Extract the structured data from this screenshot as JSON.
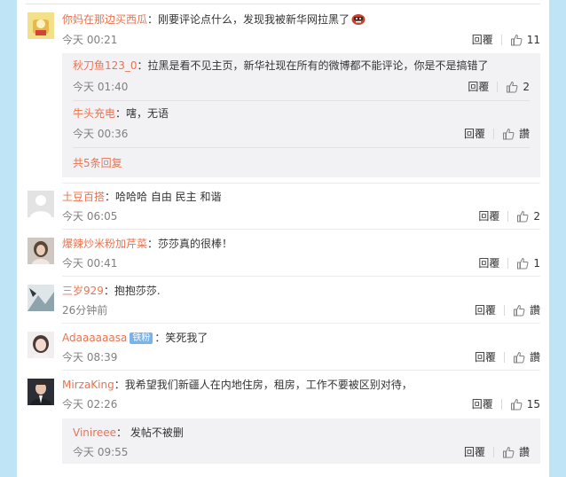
{
  "common": {
    "reply": "回覆",
    "like_placeholder": "讚"
  },
  "comments": [
    {
      "user": "你妈在那边买西瓜",
      "text": "：刚要评论点什么，发现我被新华网拉黑了",
      "time": "今天 00:21",
      "likes": "11"
    },
    {
      "user": "土豆百搭",
      "text": "：哈哈哈 自由 民主 和谐",
      "time": "今天 06:05",
      "likes": "2"
    },
    {
      "user": "爆辣炒米粉加芹菜",
      "text": "：莎莎真的很棒！",
      "time": "今天 00:41",
      "likes": "1"
    },
    {
      "user": "三岁929",
      "text": "：抱抱莎莎.",
      "time": "26分钟前",
      "likes": "讚"
    },
    {
      "user": "Adaaaaaasa",
      "badge": "铁粉",
      "text": "：笑死我了",
      "time": "今天 08:39",
      "likes": "讚"
    },
    {
      "user": "MirzaKing",
      "text": "：我希望我们新疆人在内地住房，租房，工作不要被区别对待，",
      "time": "今天 02:26",
      "likes": "15"
    }
  ],
  "replies_1": [
    {
      "user": "秋刀鱼123_0",
      "text": "：拉黑是看不见主页，新华社现在所有的微博都不能评论，你是不是搞错了",
      "time": "今天 01:40",
      "likes": "2"
    },
    {
      "user": "牛头充电",
      "text": "：嗐，无语",
      "time": "今天 00:36",
      "likes": "讚"
    }
  ],
  "more_replies": "共5条回复",
  "replies_6": [
    {
      "user": "Vinireee",
      "text": "：  发帖不被删",
      "time": "今天 09:55",
      "likes": "讚"
    }
  ],
  "colors": {
    "username": "#eb7350",
    "badge": "#7ab3e8",
    "background": "#bfe4f5"
  }
}
